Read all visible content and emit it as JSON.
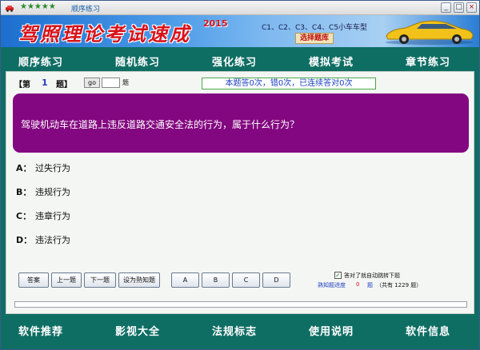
{
  "window": {
    "stars": "★★★★★",
    "title": "顺序练习",
    "minimize": "_",
    "maximize": "□",
    "close": "×"
  },
  "banner": {
    "title": "驾照理论考试速成",
    "year": "2015",
    "car_types": "C1、C2、C3、C4、C5小车车型",
    "select_bank": "选择题库"
  },
  "top_nav": [
    "顺序练习",
    "随机练习",
    "强化练习",
    "模拟考试",
    "章节练习"
  ],
  "question_bar": {
    "label": "【第",
    "number": "1",
    "unit": "题】",
    "go_label": "go",
    "go_input": "",
    "go_unit": "题",
    "stats": "本题答0次，错0次，已连续答对0次"
  },
  "question": "驾驶机动车在道路上违反道路交通安全法的行为，属于什么行为？",
  "options": [
    {
      "letter": "A：",
      "text": "过失行为"
    },
    {
      "letter": "B：",
      "text": "违规行为"
    },
    {
      "letter": "C：",
      "text": "违章行为"
    },
    {
      "letter": "D：",
      "text": "违法行为"
    }
  ],
  "buttons": {
    "answer": "答案",
    "prev": "上一题",
    "next": "下一题",
    "set_familiar": "设为熟知题",
    "a": "A",
    "b": "B",
    "c": "C",
    "d": "D"
  },
  "auto_next": {
    "checked": true,
    "mark": "✓",
    "label": "答对了就自动跳转下题"
  },
  "progress": {
    "label": "熟知题进度",
    "count": "0",
    "unit": "题",
    "total": "（共有 1229 题）",
    "fraction": 0
  },
  "bottom_nav": [
    "软件推荐",
    "影视大全",
    "法规标志",
    "使用说明",
    "软件信息"
  ],
  "colors": {
    "frame": "#0f6e64",
    "question_bg": "#830780",
    "stats_text": "#1a3fc0",
    "title_red": "#d8121a"
  }
}
